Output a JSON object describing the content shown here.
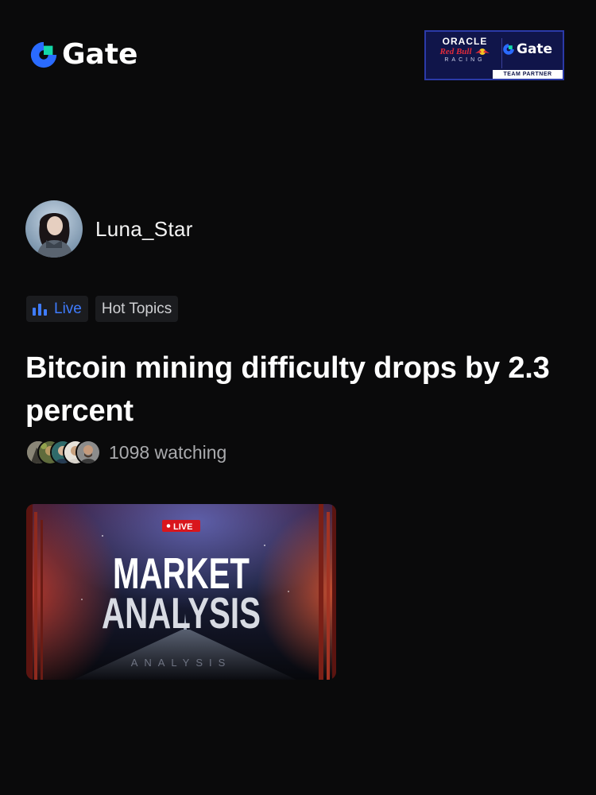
{
  "brand": {
    "name": "Gate",
    "primary": "#2a6bff",
    "accent": "#13d8a8"
  },
  "partner_badge": {
    "line1": "ORACLE",
    "line2": "Red Bull",
    "line3": "RACING",
    "brand": "Gate",
    "footer": "TEAM PARTNER"
  },
  "author": {
    "name": "Luna_Star",
    "avatar_icon": "user-portrait"
  },
  "tags": [
    {
      "label": "Live",
      "icon": "bar-chart-icon",
      "color": "#3f7cff"
    },
    {
      "label": "Hot Topics"
    }
  ],
  "post": {
    "title": "Bitcoin mining difficulty drops by 2.3 percent",
    "watching": "1098 watching"
  },
  "thumbnail": {
    "badge": "LIVE",
    "headline_1": "MARKET",
    "headline_2": "ANALYSIS",
    "subtitle": "ANALYSIS"
  }
}
